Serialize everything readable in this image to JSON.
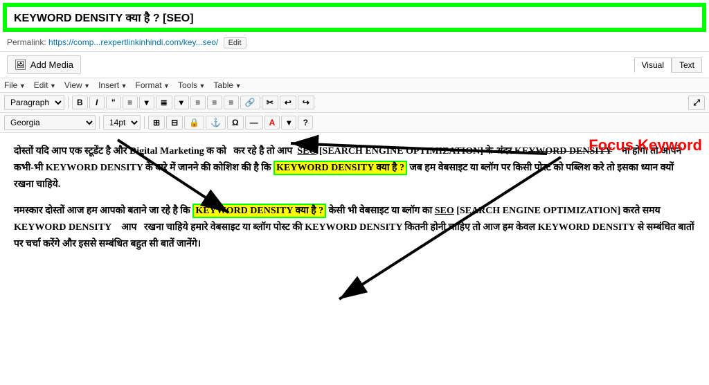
{
  "title": {
    "value": "KEYWORD DENSITY क्या है ? [SEO]",
    "border_color": "#00ff00"
  },
  "permalink": {
    "label": "Permalink:",
    "url": "https://comp...rexpertlinkinhindi.com/key...seo/",
    "edit_btn": "Edit"
  },
  "add_media": {
    "btn_label": "Add Media"
  },
  "tabs": {
    "visual": "Visual",
    "text": "Text"
  },
  "menu_bar": {
    "items": [
      "File",
      "Edit",
      "View",
      "Insert",
      "Format",
      "Tools",
      "Table"
    ]
  },
  "toolbar_row1": {
    "paragraph_select": "Paragraph",
    "buttons": [
      "B",
      "I",
      "\"",
      "≡",
      "▼",
      "≡",
      "▼",
      "≡",
      "≡",
      "≡",
      "🔗",
      "✂",
      "↩",
      "↪"
    ]
  },
  "toolbar_row2": {
    "font_select": "Georgia",
    "size_select": "14pt",
    "buttons": [
      "⊞",
      "⊟",
      "🔒",
      "🔗",
      "Ω",
      "≡",
      "A",
      "▼",
      "?"
    ]
  },
  "focus_keyword_label": "Focus Keyword",
  "content": {
    "para1": "दोस्तों यदि आप एक स्टूडेंट है और Digital Marketing क  को   कर रहे है तो आप  SEO [SEARCH ENGINE OPTIMIZATION] के अंदर KEYWORD DENSITY    ना होगा तो आपने कभी-भी KEYWORD DENSITY के बारे में जानने की कोशिश की है कि",
    "highlight1": "KEYWORD DENSITY क्या है ?",
    "para1_cont": "जब हम वेबसाइट या ब्लॉग पर किसी पोस्ट को पब्लिश करे तो इसका ध्यान क्यों रखना चाहिये.",
    "para2_start": "नमस्कार दोस्तों आज हम आपको बताने जा रहे है कि",
    "highlight2": "KEYWORD DENSITY क्या है ?",
    "para2_cont": "केसी भी वेबसाइट या ब्लॉग का SEO [SEARCH ENGINE OPTIMIZATION] करते समय KEYWORD DENSITY    आप   रखना चाहिये हमारे वेबसाइट या ब्लॉग पोस्ट की KEYWORD DENSITY कितनी होनी चाहिए तो आज हम केवल KEYWORD DENSITY से सम्बंधित बातों पर चर्चा करेंगे और इससे सम्बंधित बहुत सी बातें जानेंगे।"
  },
  "annotations": {
    "focus_keyword": "Focus Keyword"
  }
}
